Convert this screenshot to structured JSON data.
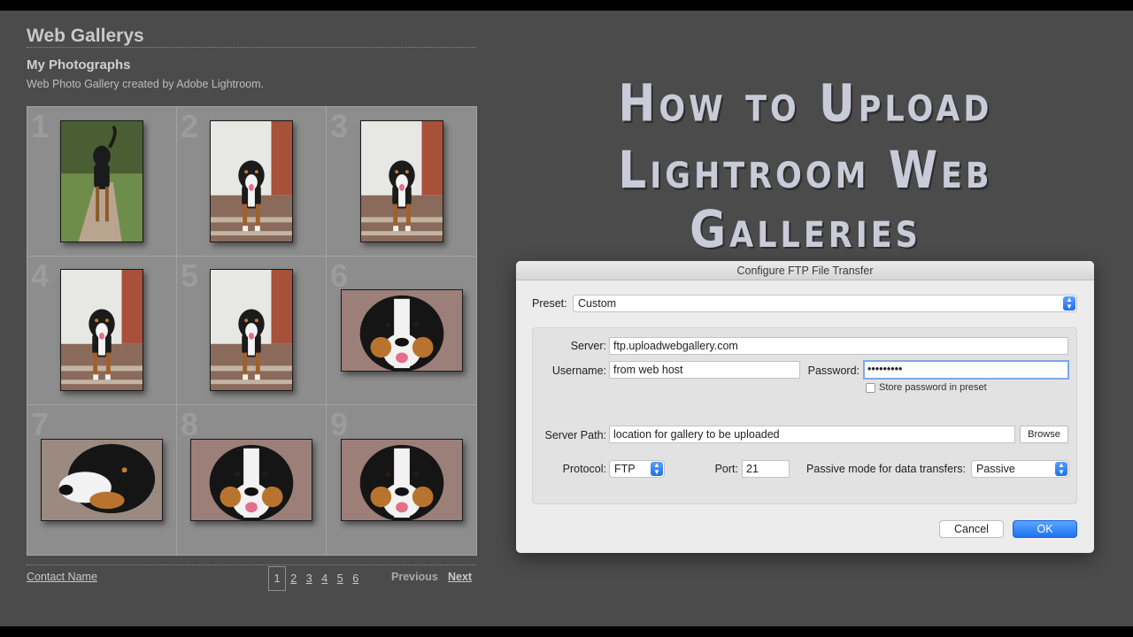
{
  "gallery": {
    "title": "Web Gallerys",
    "subtitle": "My Photographs",
    "description": "Web Photo Gallery created by Adobe Lightroom.",
    "cells": [
      {
        "number": "1",
        "orientation": "portrait",
        "scene": "dog-outdoor"
      },
      {
        "number": "2",
        "orientation": "portrait",
        "scene": "dog-steps"
      },
      {
        "number": "3",
        "orientation": "portrait",
        "scene": "dog-steps"
      },
      {
        "number": "4",
        "orientation": "portrait",
        "scene": "dog-steps"
      },
      {
        "number": "5",
        "orientation": "portrait",
        "scene": "dog-steps"
      },
      {
        "number": "6",
        "orientation": "landscape",
        "scene": "dog-face"
      },
      {
        "number": "7",
        "orientation": "landscape",
        "scene": "dog-profile"
      },
      {
        "number": "8",
        "orientation": "landscape",
        "scene": "dog-face"
      },
      {
        "number": "9",
        "orientation": "landscape",
        "scene": "dog-face"
      }
    ],
    "contact": "Contact Name",
    "pages": [
      "1",
      "2",
      "3",
      "4",
      "5",
      "6"
    ],
    "current_page": "1",
    "previous": "Previous",
    "next": "Next"
  },
  "headline": {
    "line1": "How to Upload",
    "line2": "Lightroom Web Galleries"
  },
  "dialog": {
    "title": "Configure FTP File Transfer",
    "preset_label": "Preset:",
    "preset_value": "Custom",
    "server_label": "Server:",
    "server_value": "ftp.uploadwebgallery.com",
    "username_label": "Username:",
    "username_value": "from web host",
    "password_label": "Password:",
    "password_value": "•••••••••",
    "store_password_label": "Store password in preset",
    "server_path_label": "Server Path:",
    "server_path_value": "location for gallery to be uploaded",
    "browse_label": "Browse",
    "protocol_label": "Protocol:",
    "protocol_value": "FTP",
    "port_label": "Port:",
    "port_value": "21",
    "passive_label": "Passive mode for data transfers:",
    "passive_value": "Passive",
    "cancel_label": "Cancel",
    "ok_label": "OK"
  },
  "colors": {
    "background": "#4b4b4b",
    "grid": "#8d8d8d",
    "accent_blue": "#1d73ee",
    "headline": "#c9ccd8"
  }
}
